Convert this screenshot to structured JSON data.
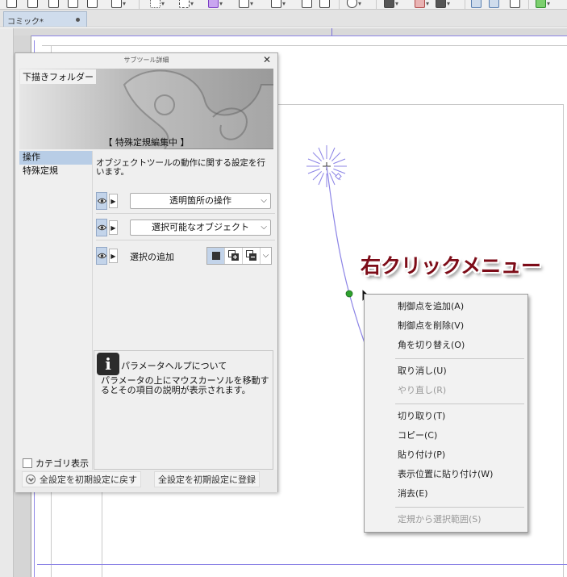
{
  "document_tab": {
    "label": "コミック*"
  },
  "panel": {
    "title": "サブツール詳細",
    "preview_folder": "下描きフォルダー",
    "preview_caption": "【 特殊定規編集中 】",
    "categories": [
      {
        "label": "操作",
        "selected": true
      },
      {
        "label": "特殊定規",
        "selected": false
      }
    ],
    "description": "オブジェクトツールの動作に関する設定を行います。",
    "properties": [
      {
        "type": "select",
        "value": "透明箇所の操作"
      },
      {
        "type": "select",
        "value": "選択可能なオブジェクト"
      },
      {
        "type": "mode",
        "label": "選択の追加"
      }
    ],
    "help": {
      "title": "パラメータヘルプについて",
      "text": "パラメータの上にマウスカーソルを移動するとその項目の説明が表示されます。"
    },
    "category_toggle_label": "カテゴリ表示",
    "reset_label": "全設定を初期設定に戻す",
    "register_label": "全設定を初期設定に登録"
  },
  "overlay_title": "右クリックメニュー",
  "context_menu": {
    "items": [
      {
        "label": "制御点を追加(A)",
        "disabled": false
      },
      {
        "label": "制御点を削除(V)",
        "disabled": false
      },
      {
        "label": "角を切り替え(O)",
        "disabled": false
      },
      {
        "separator": true
      },
      {
        "label": "取り消し(U)",
        "disabled": false
      },
      {
        "label": "やり直し(R)",
        "disabled": true
      },
      {
        "separator": true
      },
      {
        "label": "切り取り(T)",
        "disabled": false
      },
      {
        "label": "コピー(C)",
        "disabled": false
      },
      {
        "label": "貼り付け(P)",
        "disabled": false
      },
      {
        "label": "表示位置に貼り付け(W)",
        "disabled": false
      },
      {
        "label": "消去(E)",
        "disabled": false
      },
      {
        "separator": true
      },
      {
        "label": "定規から選択範囲(S)",
        "disabled": true
      }
    ]
  },
  "colors": {
    "accent_selection": "#b8cde6",
    "curve_line": "#8c84e6",
    "control_point": "#2ea12e",
    "overlay_text": "#7d0c18"
  }
}
